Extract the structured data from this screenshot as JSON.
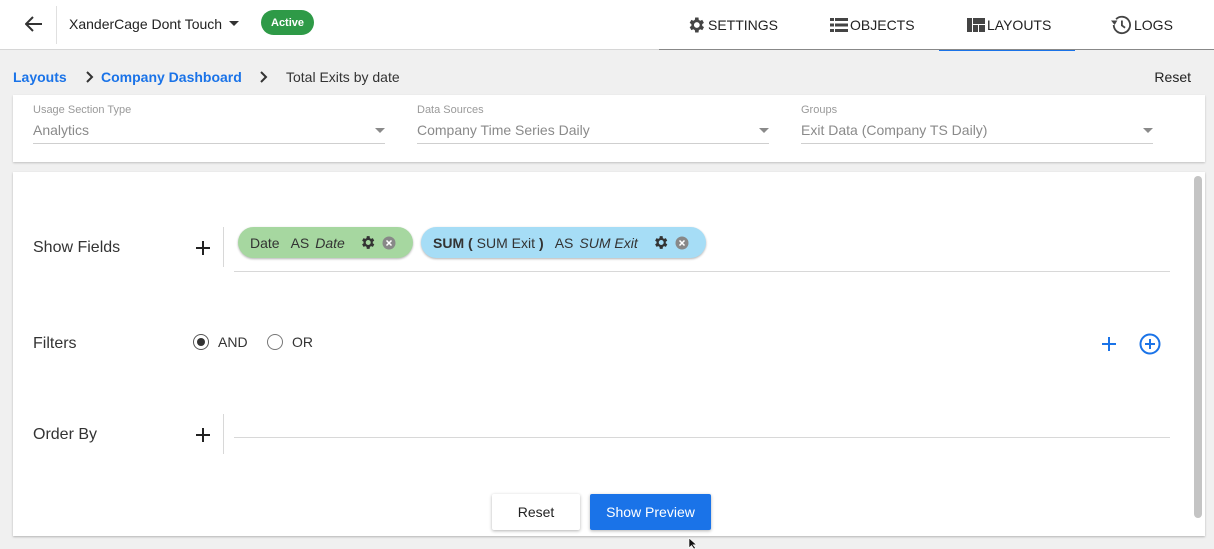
{
  "header": {
    "project_name": "XanderCage Dont Touch",
    "status": "Active",
    "nav": [
      {
        "label": "SETTINGS",
        "icon": "gear-icon"
      },
      {
        "label": "OBJECTS",
        "icon": "list-icon"
      },
      {
        "label": "LAYOUTS",
        "icon": "layout-icon",
        "active": true
      },
      {
        "label": "LOGS",
        "icon": "history-icon"
      }
    ]
  },
  "breadcrumb": {
    "items": [
      "Layouts",
      "Company Dashboard",
      "Total Exits by date"
    ],
    "reset_label": "Reset"
  },
  "selectors": {
    "usage_section_type": {
      "label": "Usage Section Type",
      "value": "Analytics"
    },
    "data_sources": {
      "label": "Data Sources",
      "value": "Company Time Series Daily"
    },
    "groups": {
      "label": "Groups",
      "value": "Exit Data (Company TS Daily)"
    }
  },
  "query": {
    "show_fields_label": "Show Fields",
    "fields": [
      {
        "field": "Date",
        "as": "AS",
        "alias": "Date"
      },
      {
        "func": "SUM (",
        "field": "SUM Exit",
        "close": ")",
        "as": "AS",
        "alias": "SUM Exit"
      }
    ],
    "filters_label": "Filters",
    "logic_options": [
      "AND",
      "OR"
    ],
    "logic_selected": "AND",
    "order_by_label": "Order By"
  },
  "actions": {
    "reset_label": "Reset",
    "preview_label": "Show Preview"
  },
  "colors": {
    "accent": "#1a73e8",
    "active_badge": "#2e9a47",
    "chip_green": "#a6d7a0",
    "chip_blue": "#a6ddf6"
  }
}
